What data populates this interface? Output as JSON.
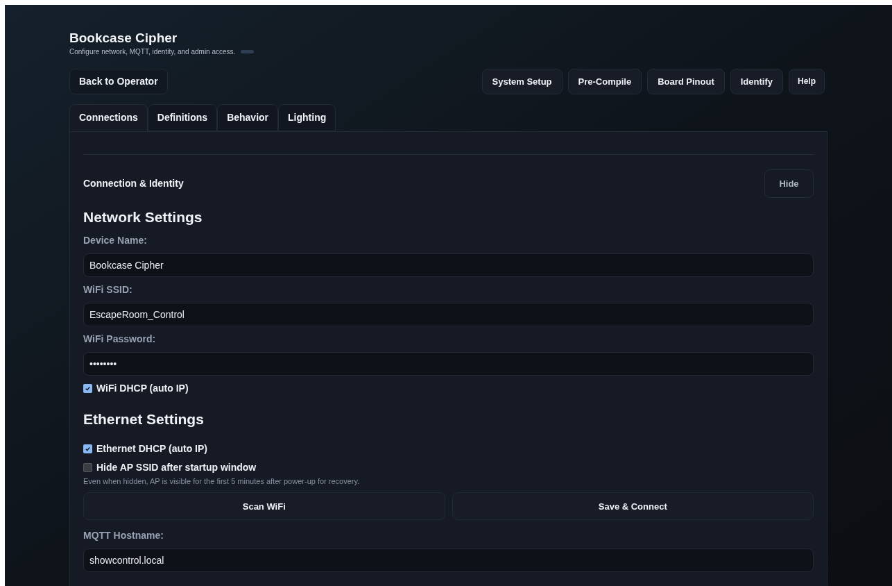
{
  "header": {
    "title": "Bookcase Cipher",
    "subtitle": "Configure network, MQTT, identity, and admin access."
  },
  "back_button": "Back to Operator",
  "toolbar": [
    "System Setup",
    "Pre-Compile",
    "Board Pinout",
    "Identify",
    "Help"
  ],
  "tabs": [
    {
      "label": "Connections",
      "selected": true
    },
    {
      "label": "Definitions",
      "selected": false
    },
    {
      "label": "Behavior",
      "selected": false
    },
    {
      "label": "Lighting",
      "selected": false
    }
  ],
  "section": {
    "title": "Connection & Identity",
    "toggle": "Hide"
  },
  "form": [
    {
      "kind": "heading",
      "text": "Network Settings"
    },
    {
      "kind": "field",
      "label": "Device Name:",
      "value": "Bookcase Cipher"
    },
    {
      "kind": "field",
      "label": "WiFi SSID:",
      "value": "EscapeRoom_Control"
    },
    {
      "kind": "field",
      "label": "WiFi Password:",
      "value": "••••••••"
    },
    {
      "kind": "checkbox",
      "label": "WiFi DHCP (auto IP)",
      "checked": true
    },
    {
      "kind": "heading",
      "text": "Ethernet Settings"
    },
    {
      "kind": "checkbox",
      "label": "Ethernet DHCP (auto IP)",
      "checked": true
    },
    {
      "kind": "checkbox",
      "label": "Hide AP SSID after startup window",
      "checked": false
    },
    {
      "kind": "note",
      "text": "Even when hidden, AP is visible for the first 5 minutes after power-up for recovery."
    },
    {
      "kind": "buttons",
      "buttons": [
        "Scan WiFi",
        "Save & Connect"
      ]
    },
    {
      "kind": "field",
      "label": "MQTT Hostname:",
      "value": "showcontrol.local"
    }
  ]
}
